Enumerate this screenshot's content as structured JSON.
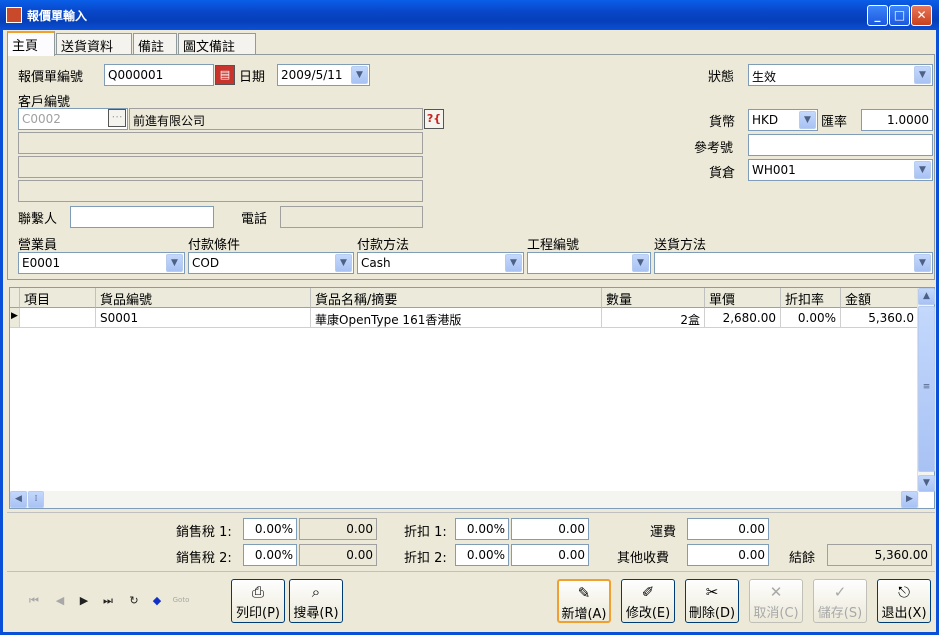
{
  "window": {
    "title": "報價單輸入",
    "minimize": "_",
    "maximize": "□",
    "close": "✕"
  },
  "tabs": [
    "主頁",
    "送貨資料",
    "備註",
    "圖文備註"
  ],
  "header": {
    "quote_no_label": "報價單編號",
    "quote_no_value": "Q000001",
    "date_label": "日期",
    "date_value": "2009/5/11",
    "status_label": "狀態",
    "status_value": "生效",
    "customer_label": "客戶編號",
    "customer_code": "C0002",
    "customer_name": "前進有限公司",
    "address_lines": [
      "",
      "",
      ""
    ],
    "currency_label": "貨幣",
    "currency_value": "HKD",
    "rate_label": "匯率",
    "rate_value": "1.0000",
    "ref_label": "參考號",
    "ref_value": "",
    "warehouse_label": "貨倉",
    "warehouse_value": "WH001",
    "contact_label": "聯繫人",
    "contact_value": "",
    "phone_label": "電話",
    "phone_value": "",
    "salesman_label": "營業員",
    "salesman_value": "E0001",
    "payterm_label": "付款條件",
    "payterm_value": "COD",
    "paymethod_label": "付款方法",
    "paymethod_value": "Cash",
    "project_label": "工程編號",
    "project_value": "",
    "ship_label": "送貨方法",
    "ship_value": ""
  },
  "grid": {
    "columns": [
      "項目",
      "貨品編號",
      "貨品名稱/摘要",
      "數量",
      "單價",
      "折扣率",
      "金額"
    ],
    "rows": [
      [
        "",
        "S0001",
        "華康OpenType 161香港版",
        "2盒",
        "2,680.00",
        "0.00%",
        "5,360.0"
      ]
    ]
  },
  "footer": {
    "tax1_label": "銷售稅 1:",
    "tax1_rate": "0.00%",
    "tax1_amt": "0.00",
    "tax2_label": "銷售稅 2:",
    "tax2_rate": "0.00%",
    "tax2_amt": "0.00",
    "disc1_label": "折扣 1:",
    "disc1_rate": "0.00%",
    "disc1_amt": "0.00",
    "disc2_label": "折扣 2:",
    "disc2_rate": "0.00%",
    "disc2_amt": "0.00",
    "freight_label": "運費",
    "freight_value": "0.00",
    "other_label": "其他收費",
    "other_value": "0.00",
    "balance_label": "結餘",
    "balance_value": "5,360.00"
  },
  "buttons": {
    "print": "列印(P)",
    "search": "搜尋(R)",
    "add": "新增(A)",
    "edit": "修改(E)",
    "delete": "刪除(D)",
    "cancel": "取消(C)",
    "save": "儲存(S)",
    "exit": "退出(X)"
  },
  "nav": {
    "goto_label": "Goto"
  }
}
